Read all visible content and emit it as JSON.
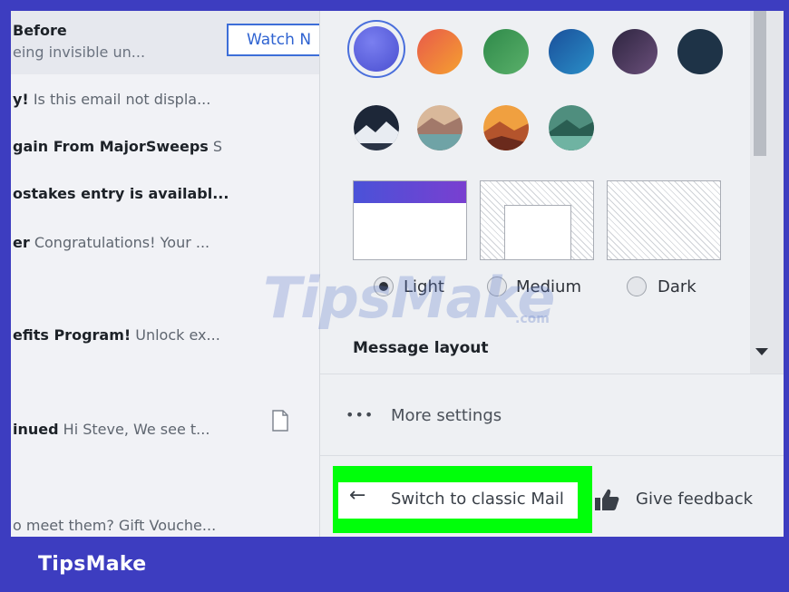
{
  "brand": "TipsMake",
  "watermark": {
    "main": "TipsMake",
    "suffix": ".com"
  },
  "mail_list": {
    "first": {
      "line1": "Before",
      "line2": "eing invisible un...",
      "button": "Watch N"
    },
    "rows": [
      {
        "bold": "y!",
        "rest": " Is this email not displa..."
      },
      {
        "bold": "gain From MajorSweeps",
        "rest": " S"
      },
      {
        "bold": "ostakes entry is availabl...",
        "rest": ""
      },
      {
        "bold": "er",
        "rest": " Congratulations! Your ..."
      },
      {
        "bold": "efits Program!",
        "rest": " Unlock ex..."
      },
      {
        "bold": "inued",
        "rest": " Hi Steve, We see t..."
      },
      {
        "bold": "",
        "rest": "o meet them? Gift Vouche..."
      }
    ]
  },
  "theme": {
    "color_swatches": [
      "#5a5fe0",
      "#f0793a",
      "#3f9b59",
      "#1f6fb2",
      "#4b3a5e",
      "#1e3347"
    ],
    "scene_swatches": [
      "night-mountain",
      "desert-lake",
      "sunset-hills",
      "green-lake"
    ],
    "modes": [
      {
        "label": "Light",
        "selected": true
      },
      {
        "label": "Medium",
        "selected": false
      },
      {
        "label": "Dark",
        "selected": false
      }
    ]
  },
  "settings": {
    "message_layout_title": "Message layout",
    "more_settings": "More settings",
    "switch_classic": "Switch to classic Mail",
    "give_feedback": "Give feedback"
  }
}
